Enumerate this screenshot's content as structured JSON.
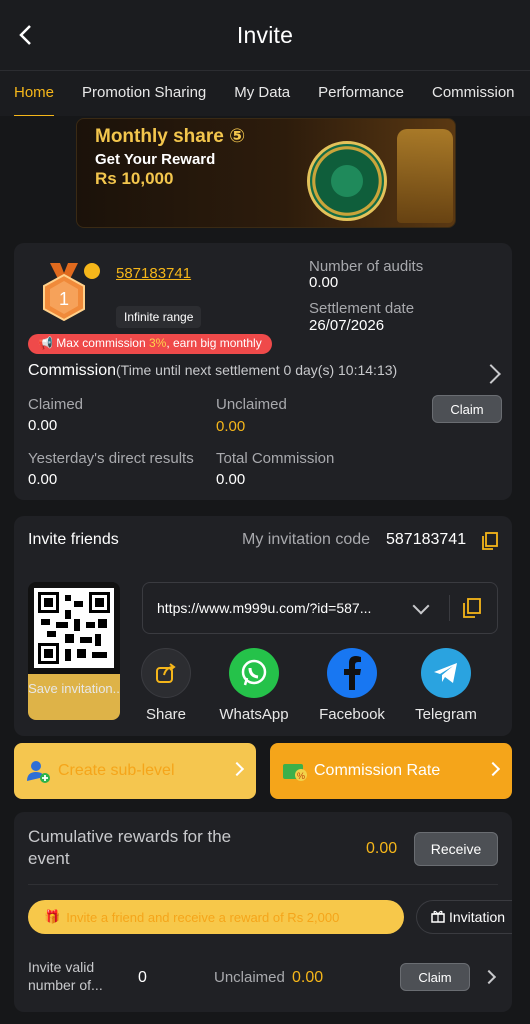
{
  "header": {
    "title": "Invite"
  },
  "tabs": [
    {
      "label": "Home"
    },
    {
      "label": "Promotion Sharing"
    },
    {
      "label": "My Data"
    },
    {
      "label": "Performance"
    },
    {
      "label": "Commission"
    }
  ],
  "banner": {
    "line1": "Monthly share ⑤",
    "line2": "Get Your Reward",
    "line3": "Rs 10,000"
  },
  "account": {
    "level": "1",
    "id": "587183741",
    "range_label": "Infinite range",
    "audits_label": "Number of audits",
    "audits_value": "0.00",
    "settlement_label": "Settlement date",
    "settlement_value": "26/07/2026",
    "max_pre": "Max commission ",
    "max_pct": "3%",
    "max_post": ", earn big monthly"
  },
  "commission": {
    "title": "Commission",
    "subtitle": "(Time until next settlement  0 day(s) 10:14:13)",
    "claimed_label": "Claimed",
    "claimed_value": "0.00",
    "unclaimed_label": "Unclaimed",
    "unclaimed_value": "0.00",
    "claim_button": "Claim",
    "yesterday_label": "Yesterday's direct results",
    "yesterday_value": "0.00",
    "total_label": "Total Commission",
    "total_value": "0.00"
  },
  "invite": {
    "title": "Invite friends",
    "code_label": "My invitation code",
    "code_value": "587183741",
    "url": "https://www.m999u.com/?id=587...",
    "save_label": "Save invitation..",
    "share_items": [
      {
        "label": "Share",
        "icon": "share-icon"
      },
      {
        "label": "WhatsApp",
        "icon": "whatsapp-icon"
      },
      {
        "label": "Facebook",
        "icon": "facebook-icon"
      },
      {
        "label": "Telegram",
        "icon": "telegram-icon"
      }
    ]
  },
  "actions": {
    "create_sublevel": "Create sub-level",
    "commission_rate": "Commission Rate"
  },
  "rewards": {
    "title": "Cumulative rewards for the event",
    "value": "0.00",
    "receive_button": "Receive",
    "invite_banner": "Invite a friend and receive a reward of Rs 2,000",
    "invite_pill": "Invitation",
    "valid_label": "Invite valid number of...",
    "valid_value": "0",
    "unclaimed_label": "Unclaimed",
    "unclaimed_value": "0.00",
    "claim_button": "Claim"
  },
  "colors": {
    "accent": "#f5b61a",
    "background": "#161719",
    "card": "#202125",
    "alert": "#ef4a4a"
  }
}
